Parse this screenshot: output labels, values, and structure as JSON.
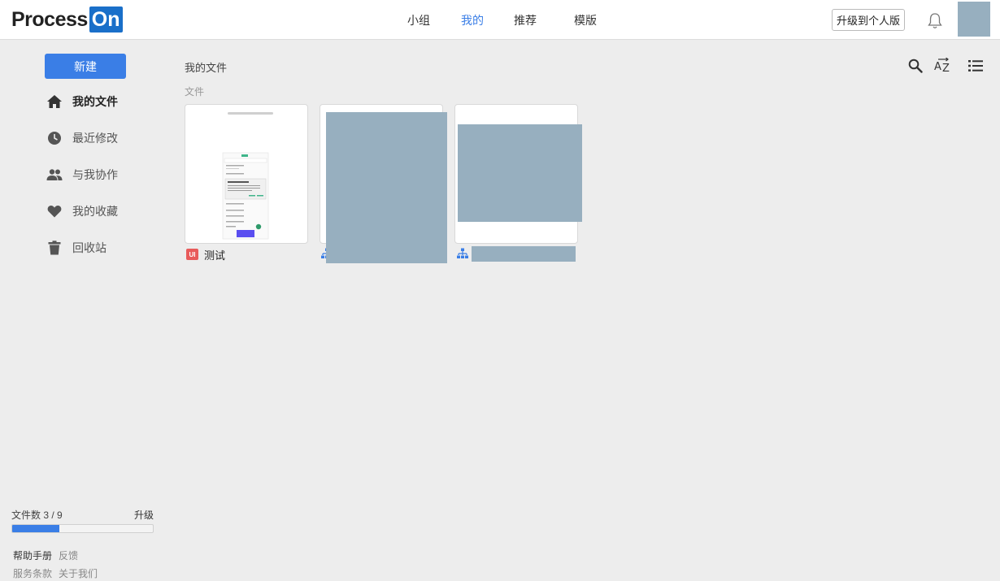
{
  "header": {
    "logo_text": "Process",
    "logo_badge": "On",
    "nav": [
      {
        "label": "小组",
        "active": false
      },
      {
        "label": "我的",
        "active": true
      },
      {
        "label": "推荐",
        "active": false
      },
      {
        "label": "模版",
        "active": false
      }
    ],
    "upgrade_label": "升级到个人版"
  },
  "sidebar": {
    "new_label": "新建",
    "items": [
      {
        "label": "我的文件",
        "icon": "home-icon",
        "active": true
      },
      {
        "label": "最近修改",
        "icon": "clock-icon",
        "active": false
      },
      {
        "label": "与我协作",
        "icon": "people-icon",
        "active": false
      },
      {
        "label": "我的收藏",
        "icon": "heart-icon",
        "active": false
      },
      {
        "label": "回收站",
        "icon": "trash-icon",
        "active": false
      }
    ],
    "file_count": "文件数 3 / 9",
    "file_count_fraction": 0.333,
    "upgrade_label": "升级",
    "footer_row1": [
      "帮助手册",
      "反馈"
    ],
    "footer_row2": [
      "服务条款",
      "关于我们"
    ]
  },
  "main": {
    "breadcrumb": "我的文件",
    "section_label": "文件",
    "files": [
      {
        "name": "测试",
        "type_badge": "UI"
      },
      {
        "name": "",
        "type_icon": "org-chart-icon"
      },
      {
        "name": "",
        "type_icon": "org-chart-icon"
      }
    ]
  },
  "colors": {
    "accent": "#3a7ee6",
    "logo_blue": "#1a6fc9",
    "redaction": "#97afbf",
    "ui_badge": "#e85b5b"
  }
}
